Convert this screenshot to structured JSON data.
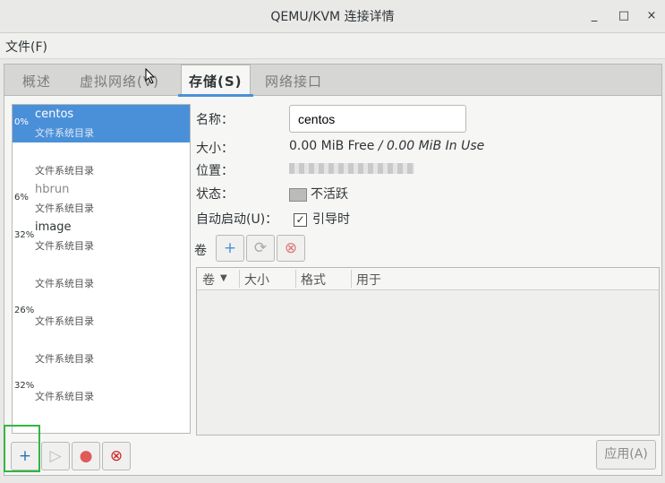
{
  "window": {
    "title": "QEMU/KVM 连接详情",
    "minimize": "_",
    "maximize": "□",
    "close": "×"
  },
  "menu": {
    "file": "文件(F)"
  },
  "tabs": [
    {
      "label": "概述"
    },
    {
      "label": "虚拟网络(V)"
    },
    {
      "label": "存储(S)"
    },
    {
      "label": "网络接口"
    }
  ],
  "pools": [
    {
      "pct": "0%",
      "name": "centos",
      "type": "文件系统目录"
    },
    {
      "pct": "",
      "name": "",
      "type": "文件系统目录"
    },
    {
      "pct": "6%",
      "name": "hbrun",
      "type": "文件系统目录"
    },
    {
      "pct": "32%",
      "name": "image",
      "type": "文件系统目录"
    },
    {
      "pct": "",
      "name": "",
      "type": "文件系统目录"
    },
    {
      "pct": "26%",
      "name": "",
      "type": "文件系统目录"
    },
    {
      "pct": "",
      "name": "",
      "type": "文件系统目录"
    },
    {
      "pct": "32%",
      "name": "",
      "type": "文件系统目录"
    }
  ],
  "details": {
    "name_label": "名称：",
    "name_value": "centos",
    "size_label": "大小：",
    "size_free": "0.00 MiB Free",
    "size_sep": " / ",
    "size_inuse": "0.00 MiB In Use",
    "location_label": "位置：",
    "state_label": "状态：",
    "state_value": "不活跃",
    "autostart_label": "自动启动(U)：",
    "autostart_value": "引导时",
    "volumes_label": "卷"
  },
  "volume_columns": [
    "卷",
    "大小",
    "格式",
    "用于"
  ],
  "apply_label": "应用(A)",
  "icons": {
    "add": "+",
    "refresh": "⟳",
    "delete": "⊗",
    "play": "▷",
    "stop": "●"
  }
}
